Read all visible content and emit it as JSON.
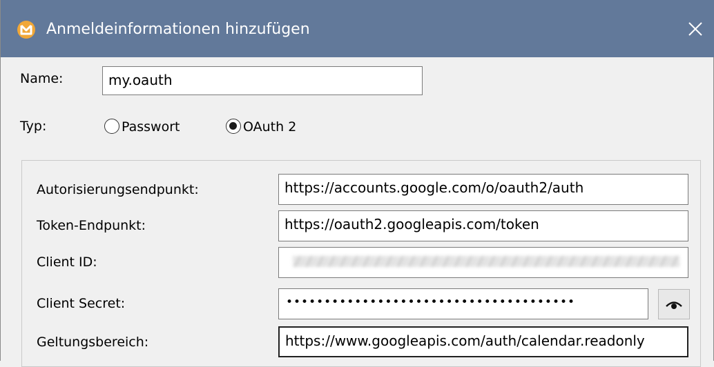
{
  "window": {
    "title": "Anmeldeinformationen hinzufügen"
  },
  "icons": {
    "app": "altova-app-icon",
    "close": "close-icon",
    "reveal": "eye-icon"
  },
  "colors": {
    "titlebar": "#62799a",
    "app_icon": "#f1a737",
    "background": "#f0f0f0"
  },
  "name": {
    "label": "Name:",
    "value": "my.oauth"
  },
  "type": {
    "label": "Typ:",
    "options": [
      {
        "label": "Passwort",
        "selected": false
      },
      {
        "label": "OAuth 2",
        "selected": true
      }
    ]
  },
  "oauth": {
    "auth_endpoint": {
      "label": "Autorisierungsendpunkt:",
      "value": "https://accounts.google.com/o/oauth2/auth"
    },
    "token_endpoint": {
      "label": "Token-Endpunkt:",
      "value": "https://oauth2.googleapis.com/token"
    },
    "client_id": {
      "label": "Client ID:"
    },
    "client_secret": {
      "label": "Client Secret:",
      "value": "••••••••••••••••••••••••••••••••••••••"
    },
    "scope": {
      "label": "Geltungsbereich:",
      "value": "https://www.googleapis.com/auth/calendar.readonly"
    }
  }
}
